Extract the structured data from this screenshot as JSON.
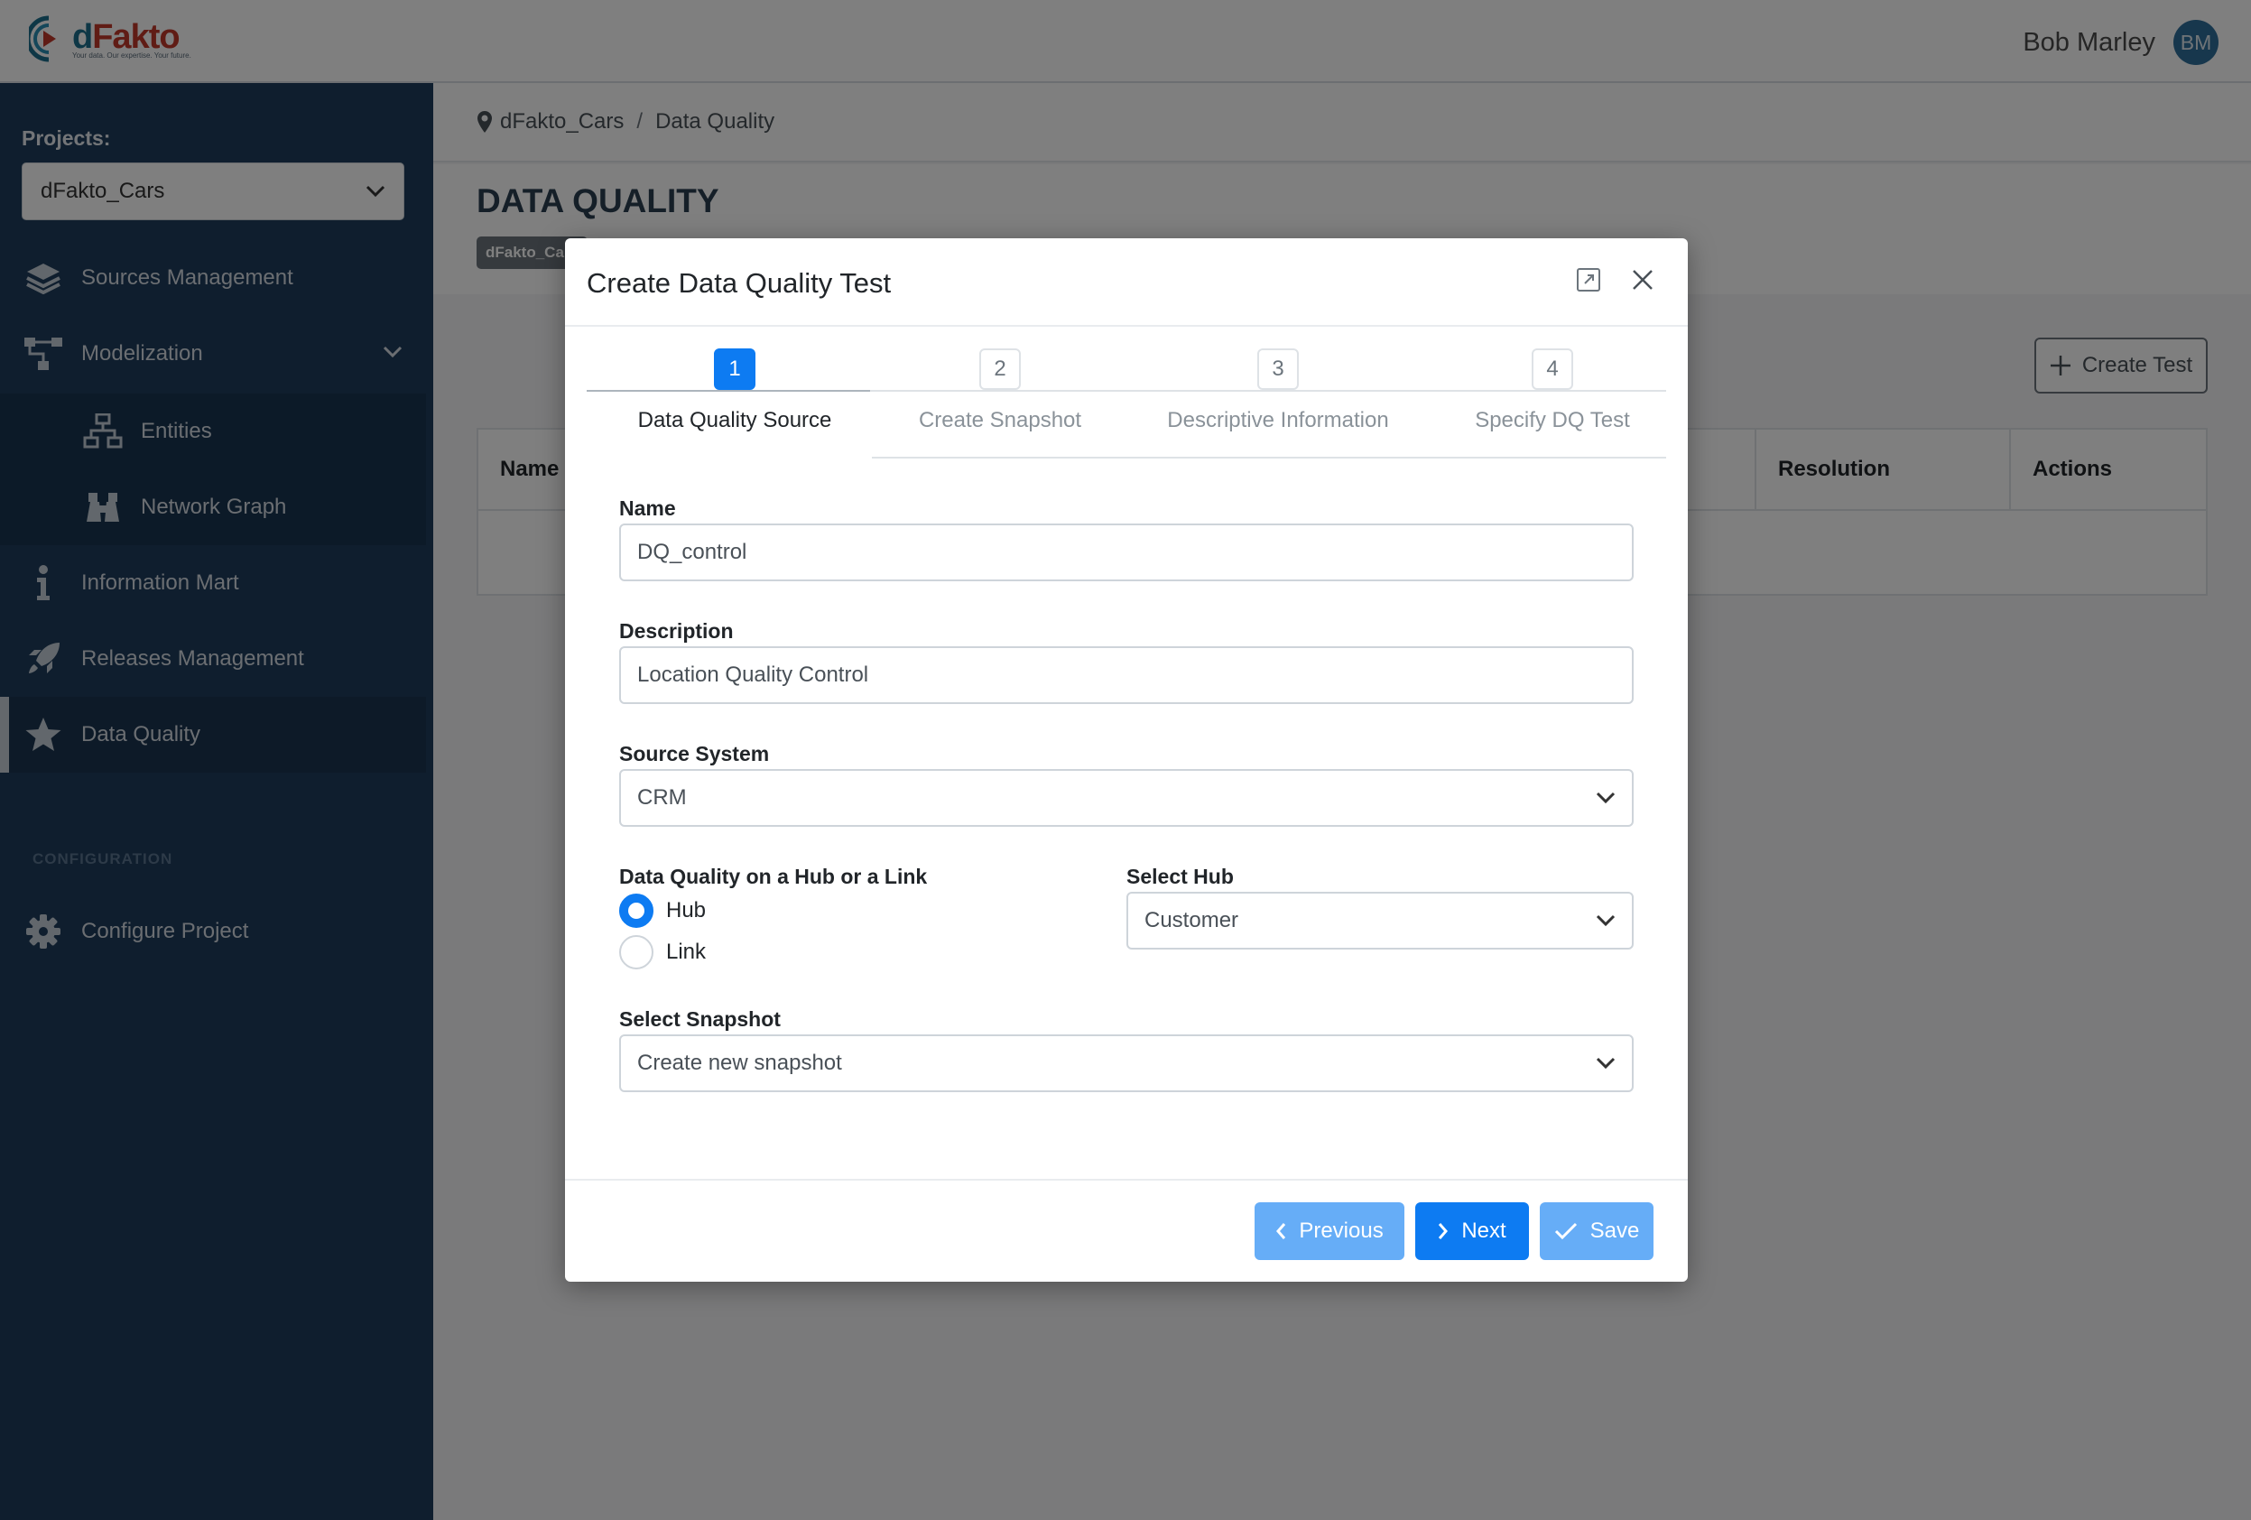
{
  "header": {
    "logo_name_a": "d",
    "logo_name_b": "Fakto",
    "logo_tagline": "Your data. Our expertise. Your future.",
    "user_name": "Bob Marley",
    "user_initials": "BM"
  },
  "sidebar": {
    "projects_label": "Projects:",
    "project_selected": "dFakto_Cars",
    "items": [
      {
        "label": "Sources Management",
        "icon": "layers-icon"
      },
      {
        "label": "Modelization",
        "icon": "diagram-icon"
      },
      {
        "label": "Entities",
        "icon": "sitemap-icon"
      },
      {
        "label": "Network Graph",
        "icon": "binoculars-icon"
      },
      {
        "label": "Information Mart",
        "icon": "info-icon"
      },
      {
        "label": "Releases Management",
        "icon": "rocket-icon"
      },
      {
        "label": "Data Quality",
        "icon": "star-icon"
      }
    ],
    "config_label": "CONFIGURATION",
    "configure_project": "Configure Project"
  },
  "main": {
    "breadcrumb": [
      "dFakto_Cars",
      "Data Quality"
    ],
    "breadcrumb_sep": "/",
    "page_title": "DATA QUALITY",
    "project_badge": "dFakto_Cars",
    "create_test_label": "Create Test",
    "table_headers": [
      "Name",
      "Resolution",
      "Actions"
    ]
  },
  "modal": {
    "title": "Create Data Quality Test",
    "steps": [
      {
        "num": "1",
        "label": "Data Quality Source"
      },
      {
        "num": "2",
        "label": "Create Snapshot"
      },
      {
        "num": "3",
        "label": "Descriptive Information"
      },
      {
        "num": "4",
        "label": "Specify DQ Test"
      }
    ],
    "name_label": "Name",
    "name_value": "DQ_control",
    "description_label": "Description",
    "description_value": "Location Quality Control",
    "source_system_label": "Source System",
    "source_system_value": "CRM",
    "hub_link_label": "Data Quality on a Hub or a Link",
    "radio_hub": "Hub",
    "radio_link": "Link",
    "select_hub_label": "Select Hub",
    "select_hub_value": "Customer",
    "select_snapshot_label": "Select Snapshot",
    "select_snapshot_value": "Create new snapshot",
    "btn_previous": "Previous",
    "btn_next": "Next",
    "btn_save": "Save"
  },
  "colors": {
    "sidebar_bg": "#1e3d5c",
    "primary": "#0d7bf2",
    "primary_light": "#66adf7"
  }
}
